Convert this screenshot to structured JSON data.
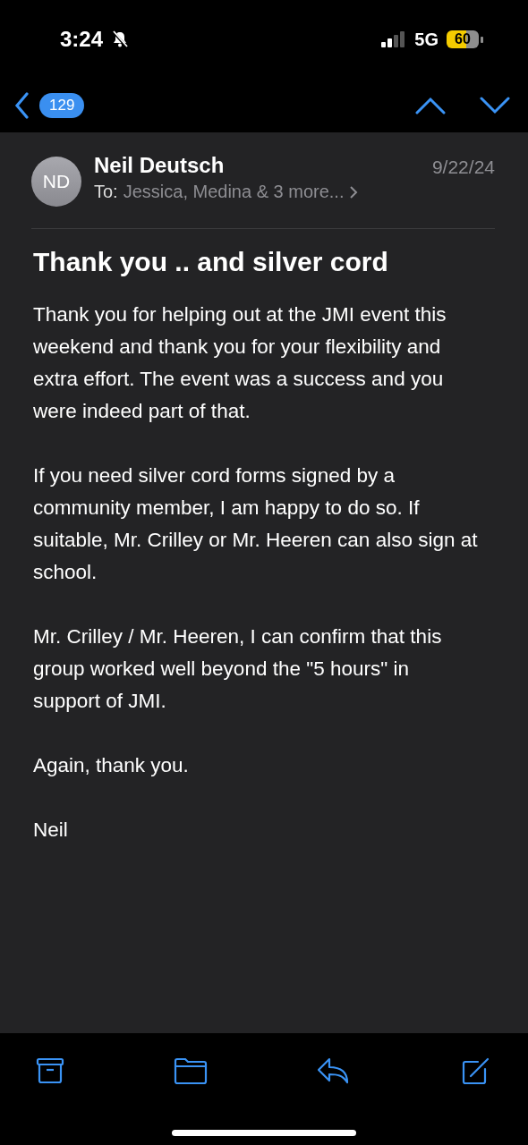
{
  "status_bar": {
    "time": "3:24",
    "network": "5G",
    "battery": "60"
  },
  "nav": {
    "unread_count": "129"
  },
  "message": {
    "initials": "ND",
    "sender": "Neil Deutsch",
    "date": "9/22/24",
    "to_label": "To:",
    "recipients": "Jessica, Medina & 3 more...",
    "subject": "Thank you .. and silver cord",
    "paragraphs": [
      "Thank you for helping out at the JMI event this weekend and thank you for your flexibility and extra effort.  The event was a success and you were indeed part of that.",
      "If you need silver cord forms signed by a community member, I am happy to do so.  If suitable, Mr. Crilley or Mr. Heeren can also sign at school.",
      "Mr. Crilley / Mr. Heeren, I can confirm that this group worked well beyond the \"5 hours\" in support of JMI.",
      "Again, thank you.",
      "Neil"
    ]
  }
}
